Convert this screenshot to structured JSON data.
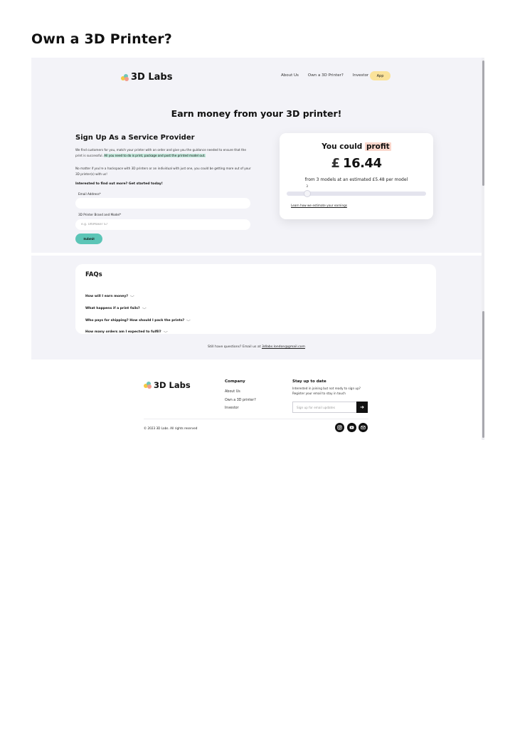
{
  "page": {
    "heading": "Own a 3D Printer?"
  },
  "nav": {
    "logo_text": "3D Labs",
    "links": [
      "About Us",
      "Own a 3D Printer?",
      "Investor"
    ],
    "app_button": "App"
  },
  "hero": {
    "title": "Earn money from your 3D printer!"
  },
  "signup": {
    "title": "Sign Up As a Service Provider",
    "p1_text": "We find customers for you, match your printer with an order and give you the guidance needed to ensure that the print is successful.",
    "p1_highlight": "All you need to do is print, package and post the printed model out.",
    "p2": "No matter if you're a hackspace with 3D printers or an individual with just one, you could be getting more out of your 3D printer(s) with us!",
    "cta": "Interested to find out more? Get started today!",
    "email_label": "Email Address*",
    "email_value": "",
    "printer_label": "3D Printer Brand and Model*",
    "printer_placeholder": "e.g. UltiMaker S7",
    "submit": "Submit"
  },
  "profit": {
    "could_prefix": "You could",
    "could_word": "profit",
    "currency": "£",
    "amount": "16.44",
    "from_line": "from 3 models at an estimated £5.48 per model",
    "slider_value": "3",
    "slider_fraction": 0.15,
    "learn_link": "Learn how we estimate your earnings"
  },
  "faq": {
    "title": "FAQs",
    "questions": [
      "How will I earn money?",
      "What happens if a print fails?",
      "Who pays for shipping? How should I pack the prints?",
      "How many orders am I expected to fulfil?"
    ],
    "still_text": "Still have questions? Email us at",
    "email": "3dlabs.london@gmail.com"
  },
  "footer": {
    "logo_text": "3D Labs",
    "company_heading": "Company",
    "company_links": [
      "About Us",
      "Own a 3D printer?",
      "Investor"
    ],
    "stay_heading": "Stay up to date",
    "stay_blurb": "Interested in joining but not ready to sign up? Register your email to stay in touch",
    "email_placeholder": "Sign up for email updates",
    "copyright": "© 2023 3D Labs. All rights reserved",
    "social_icons": [
      "instagram-icon",
      "youtube-icon",
      "mail-icon"
    ]
  },
  "colors": {
    "hero_bg": "#f3f3f8",
    "accent_teal": "#5cc5b7",
    "app_yellow": "#fbe39a",
    "profit_highlight": "#fbd7cc",
    "text_highlight": "#bfe7d9"
  }
}
